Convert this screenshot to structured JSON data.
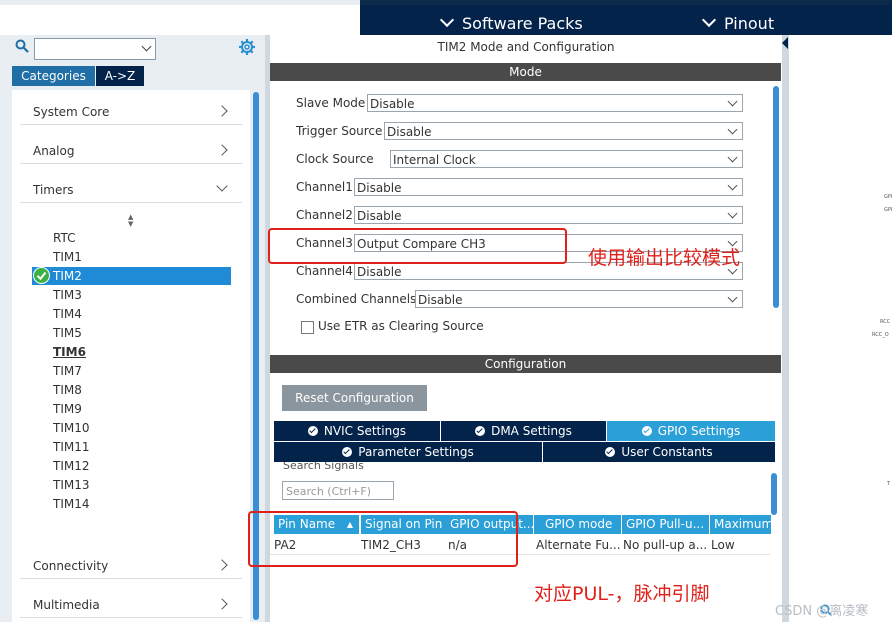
{
  "menubar": {
    "software_packs": "Software Packs",
    "pinout": "Pinout"
  },
  "sidebar": {
    "search_placeholder": "",
    "tabs": {
      "categories": "Categories",
      "az": "A->Z"
    },
    "categories": [
      "System Core",
      "Analog",
      "Timers",
      "Connectivity",
      "Multimedia"
    ],
    "timers": [
      "RTC",
      "TIM1",
      "TIM2",
      "TIM3",
      "TIM4",
      "TIM5",
      "TIM6",
      "TIM7",
      "TIM8",
      "TIM9",
      "TIM10",
      "TIM11",
      "TIM12",
      "TIM13",
      "TIM14"
    ],
    "selected_timer": "TIM2"
  },
  "mode": {
    "title": "TIM2 Mode and Configuration",
    "header": "Mode",
    "fields": [
      {
        "label": "Slave Mode",
        "value": "Disable"
      },
      {
        "label": "Trigger Source",
        "value": "Disable"
      },
      {
        "label": "Clock Source",
        "value": "Internal Clock"
      },
      {
        "label": "Channel1",
        "value": "Disable"
      },
      {
        "label": "Channel2",
        "value": "Disable"
      },
      {
        "label": "Channel3",
        "value": "Output Compare CH3"
      },
      {
        "label": "Channel4",
        "value": "Disable"
      },
      {
        "label": "Combined Channels",
        "value": "Disable"
      }
    ],
    "etr_checkbox": "Use ETR as Clearing Source"
  },
  "config": {
    "header": "Configuration",
    "reset_button": "Reset Configuration",
    "tabs_row1": [
      "NVIC Settings",
      "DMA Settings",
      "GPIO Settings"
    ],
    "tabs_row2": [
      "Parameter Settings",
      "User Constants"
    ],
    "active_tab": "GPIO Settings",
    "search_label": "Search Signals",
    "search_placeholder": "Search (Ctrl+F)",
    "table": {
      "headers": [
        "Pin Name",
        "Signal on Pin",
        "GPIO output...",
        "GPIO mode",
        "GPIO Pull-u...",
        "Maximum"
      ],
      "rows": [
        [
          "PA2",
          "TIM2_CH3",
          "n/a",
          "Alternate Fu...",
          "No pull-up a...",
          "Low"
        ]
      ]
    }
  },
  "annotations": {
    "mode_note": "使用输出比较模式",
    "pin_note": "对应PUL-，脉冲引脚"
  },
  "watermark": "CSDN @离凌寒",
  "colors": {
    "navy": "#03234b",
    "accent_blue": "#2a9fd8",
    "annotation_red": "#e0201a",
    "selected_green": "#3cb043"
  }
}
